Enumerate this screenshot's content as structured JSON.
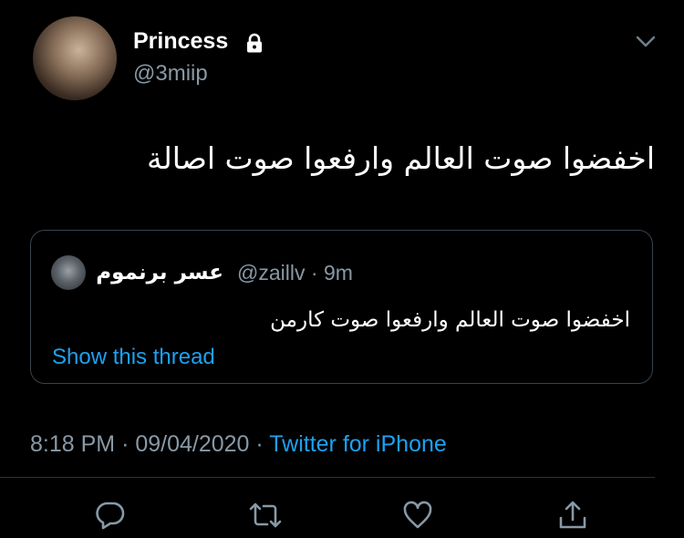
{
  "tweet": {
    "author_name": "Princess",
    "author_handle": "@3miip",
    "text": "اخفضوا صوت العالم وارفعوا صوت اصالة"
  },
  "quoted_tweet": {
    "author_name": "عسر برنموم",
    "author_handle": "@zaillv",
    "time_ago": "9m",
    "separator": "·",
    "text": "اخفضوا صوت العالم وارفعوا صوت كارمن",
    "show_thread_label": "Show this thread"
  },
  "meta": {
    "time": "8:18 PM",
    "date": "09/04/2020",
    "separator": "·",
    "source": "Twitter for iPhone"
  },
  "actions": [
    {
      "name": "reply-icon"
    },
    {
      "name": "retweet-icon"
    },
    {
      "name": "like-icon"
    },
    {
      "name": "share-icon"
    }
  ],
  "colors": {
    "background": "#000000",
    "text": "#ffffff",
    "secondary_text": "#8899a6",
    "accent": "#1da1f2",
    "border": "#38444d"
  }
}
